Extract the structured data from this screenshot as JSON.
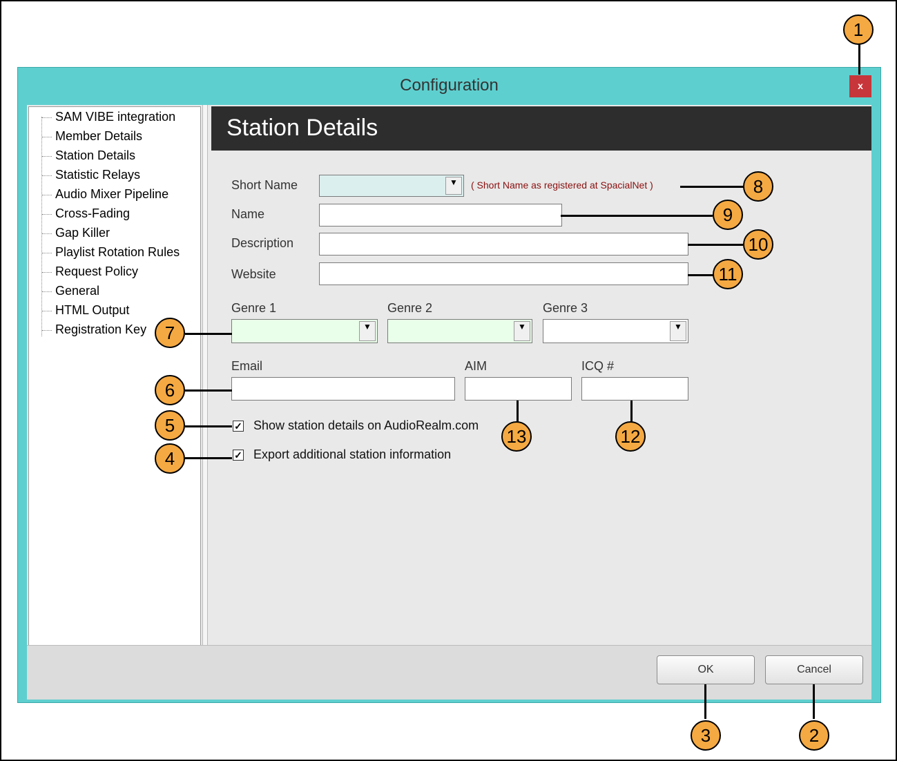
{
  "window": {
    "title": "Configuration",
    "close_label": "x"
  },
  "tree": {
    "items": [
      "SAM VIBE integration",
      "Member Details",
      "Station Details",
      "Statistic Relays",
      "Audio Mixer Pipeline",
      "Cross-Fading",
      "Gap Killer",
      "Playlist Rotation Rules",
      "Request Policy",
      "General",
      "HTML Output",
      "Registration Key"
    ]
  },
  "panel": {
    "title": "Station Details",
    "short_name_label": "Short Name",
    "short_name_hint": "( Short Name as registered at SpacialNet )",
    "name_label": "Name",
    "description_label": "Description",
    "website_label": "Website",
    "genre1_label": "Genre 1",
    "genre2_label": "Genre 2",
    "genre3_label": "Genre 3",
    "email_label": "Email",
    "aim_label": "AIM",
    "icq_label": "ICQ #",
    "show_details_label": "Show station details on AudioRealm.com",
    "export_label": "Export additional station information"
  },
  "colors": {
    "short_name_bg": "#dcefef",
    "genre_bg": "#eaffea"
  },
  "footer": {
    "ok_label": "OK",
    "cancel_label": "Cancel"
  },
  "callouts": [
    "1",
    "2",
    "3",
    "4",
    "5",
    "6",
    "7",
    "8",
    "9",
    "10",
    "11",
    "12",
    "13"
  ]
}
